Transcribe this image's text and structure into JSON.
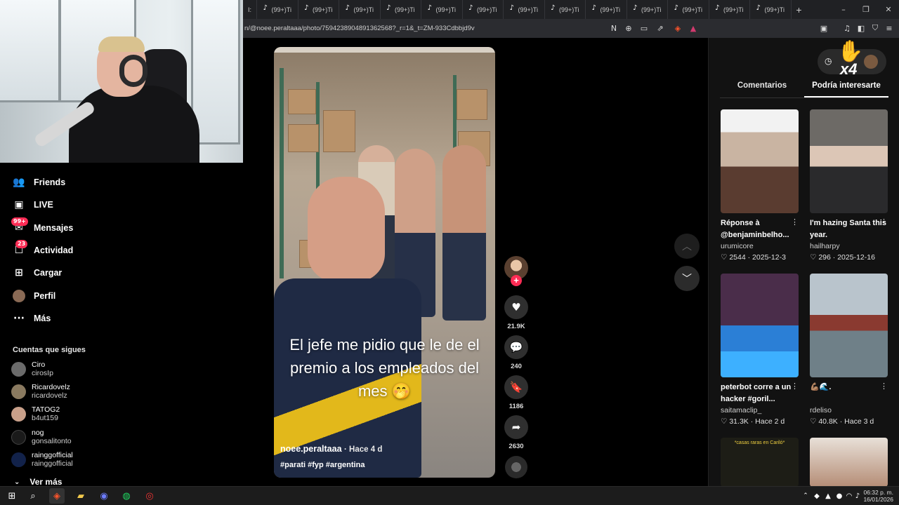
{
  "browser": {
    "tab_label": "(99+)Ti",
    "tabs": [
      "(99+)Ti",
      "(99+)Ti",
      "(99+)Ti",
      "(99+)Ti",
      "(99+)Ti",
      "(99+)Ti",
      "(99+)Ti",
      "(99+)Ti",
      "(99+)Ti",
      "(99+)Ti",
      "(99+)Ti",
      "(99+)Ti",
      "(99+)Ti"
    ],
    "url": "n/@noee.peraltaaa/photo/7594238904891362568?_r=1&_t=ZM-933Cdbbjd9v"
  },
  "sidebar": {
    "items": [
      {
        "label": "Friends",
        "icon": "friends-icon"
      },
      {
        "label": "LIVE",
        "icon": "live-icon"
      },
      {
        "label": "Mensajes",
        "icon": "messages-icon",
        "badge": "99+"
      },
      {
        "label": "Actividad",
        "icon": "activity-icon",
        "badge": "23"
      },
      {
        "label": "Cargar",
        "icon": "upload-icon"
      },
      {
        "label": "Perfil",
        "icon": "profile-icon"
      },
      {
        "label": "Más",
        "icon": "more-icon"
      }
    ],
    "following_title": "Cuentas que sigues",
    "following": [
      {
        "name": "Ciro",
        "user": "cirosIp"
      },
      {
        "name": "Ricardovelz",
        "user": "ricardovelz"
      },
      {
        "name": "TATOG2",
        "user": "b4ut159"
      },
      {
        "name": "nog",
        "user": "gonsalitonto"
      },
      {
        "name": "rainggofficial",
        "user": "rainggofficial"
      }
    ],
    "see_more": "Ver más"
  },
  "video": {
    "caption": "El jefe me pidio que le de el premio a los empleados del mes 🤭",
    "author": "noee.peraltaaa",
    "time": "· Hace 4 d",
    "tags": "#parati #fyp #argentina"
  },
  "actions": {
    "likes": "21.9K",
    "comments": "240",
    "saves": "1186",
    "shares": "2630"
  },
  "right_panel": {
    "tabs": [
      "Comentarios",
      "Podría interesarte"
    ],
    "active_tab": "Podría interesarte",
    "overlay_text": "x4",
    "cards": [
      {
        "title": "Réponse à @benjaminbelho...",
        "author": "urumicore",
        "likes": "2544",
        "date": "2025-12-3"
      },
      {
        "title": "I'm hazing Santa this year.",
        "author": "hailharpy",
        "likes": "296",
        "date": "2025-12-16"
      },
      {
        "title": "peterbot corre a un hacker #goril...",
        "author": "saitamaclip_",
        "likes": "31.3K",
        "date": "Hace 2 d"
      },
      {
        "title": "💪🏽🌊.",
        "author": "rdeliso",
        "likes": "40.8K",
        "date": "Hace 3 d"
      }
    ],
    "bottom_card_caption": "*casas raras en Cariló*"
  },
  "taskbar": {
    "time": "06:32 p. m.",
    "date": "16/01/2026"
  }
}
